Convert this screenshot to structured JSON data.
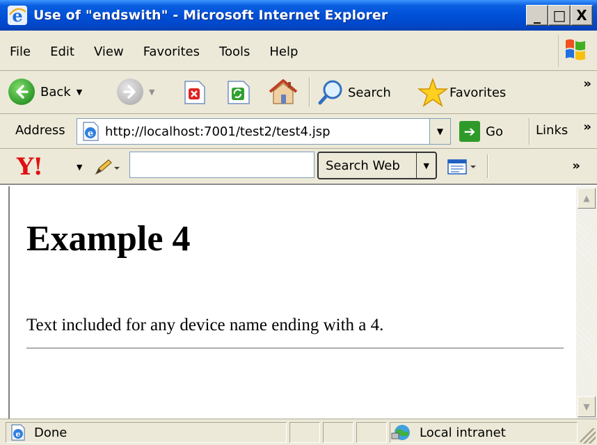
{
  "window": {
    "title": "Use of \"endswith\" - Microsoft Internet Explorer",
    "minimize": "_",
    "maximize": "□",
    "close": "X"
  },
  "menu": {
    "items": [
      "File",
      "Edit",
      "View",
      "Favorites",
      "Tools",
      "Help"
    ]
  },
  "toolbar": {
    "back_label": "Back",
    "search_label": "Search",
    "favorites_label": "Favorites",
    "more": "»"
  },
  "address": {
    "label": "Address",
    "url": "http://localhost:7001/test2/test4.jsp",
    "go_label": "Go",
    "links_label": "Links",
    "more": "»"
  },
  "yahoo": {
    "logo": "Y!",
    "search_value": "",
    "search_button": "Search Web",
    "more": "»"
  },
  "page": {
    "heading": "Example 4",
    "text": "Text included for any device name ending with a 4."
  },
  "status": {
    "text": "Done",
    "zone": "Local intranet"
  },
  "icons": [
    "ie-logo-icon",
    "windows-flag-icon",
    "back-arrow-icon",
    "forward-arrow-icon",
    "stop-icon",
    "refresh-icon",
    "home-icon",
    "search-magnifier-icon",
    "favorites-star-icon",
    "page-icon",
    "go-arrow-icon",
    "yahoo-logo-icon",
    "pencil-icon",
    "toolbar-options-icon",
    "intranet-icon"
  ],
  "colors": {
    "titlebar": "#0050d8",
    "chrome": "#ece9d8",
    "yahoo_red": "#e01010",
    "go_green": "#2f9a2a"
  }
}
